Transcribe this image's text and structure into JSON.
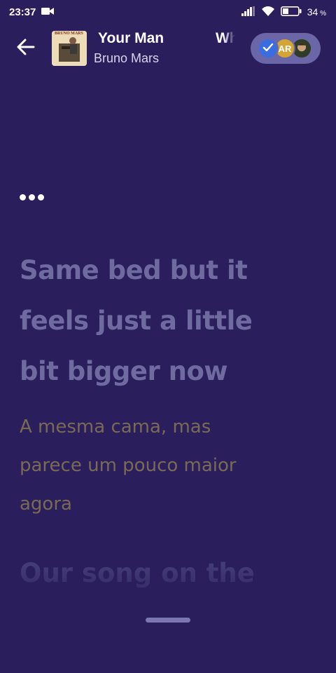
{
  "status_bar": {
    "time": "23:37",
    "battery": "34"
  },
  "header": {
    "title": "Your Man",
    "artist": "Bruno Mars",
    "next_title": "When I Was Your Man",
    "album_art_text": "BRUNO MARS",
    "language_pill": {
      "ar_label": "AR"
    }
  },
  "lyrics": {
    "main_lines": [
      "Same bed but it",
      "feels just a little",
      "bit bigger now"
    ],
    "translation_lines": [
      "A mesma cama, mas",
      "parece um pouco maior",
      "agora"
    ],
    "next_line": "Our song on the"
  },
  "colors": {
    "background": "#2a1f5c",
    "lyric_main": "#6f6a9f",
    "lyric_translation": "#7a6a55",
    "pill": "#6b66a8",
    "check_badge": "#3b6de0",
    "ar_badge": "#d4a435"
  },
  "icons": {
    "back": "arrow-left-icon",
    "video": "video-camera-icon",
    "signal": "signal-icon",
    "wifi": "wifi-icon",
    "battery": "battery-icon",
    "check": "check-icon"
  }
}
